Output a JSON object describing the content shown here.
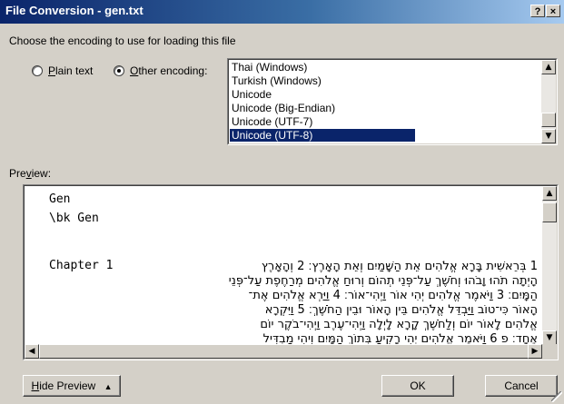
{
  "window": {
    "title": "File Conversion - gen.txt",
    "help_label": "?",
    "close_label": "×"
  },
  "prompt": "Choose the encoding to use for loading this file",
  "options": {
    "plain_text": {
      "label": "Plain text",
      "selected": false
    },
    "other_encoding": {
      "label": "Other encoding:",
      "selected": true
    }
  },
  "encodings": {
    "items": [
      "Thai (Windows)",
      "Turkish (Windows)",
      "Unicode",
      "Unicode (Big-Endian)",
      "Unicode (UTF-7)",
      "Unicode (UTF-8)"
    ],
    "selected": "Unicode (UTF-8)"
  },
  "preview": {
    "label": "Preview:",
    "lines": [
      "Gen",
      "\\bk Gen",
      "",
      "Chapter 1"
    ],
    "hebrew_lines": [
      "1 בְּרֵאשִׁית בָּרָא אֱלֹהִים אֵת הַשָּׁמַיִם וְאֵת הָאָרֶץ׃ 2 וְהָאָרֶץ",
      "הָיְתָה תֹהוּ וָבֹהוּ וְחֹשֶׁךְ עַל־פְּנֵי תְהוֹם וְרוּחַ אֱלֹהִים מְרַחֶפֶת עַל־פְּנֵי",
      "הַמָּיִם׃ 3 וַיֹּאמֶר אֱלֹהִים יְהִי אוֹר וַיְהִי־אוֹר׃ 4 וַיַּרְא אֱלֹהִים אֶת־",
      "הָאוֹר כִּי־טוֹב וַיַּבְדֵּל אֱלֹהִים בֵּין הָאוֹר וּבֵין הַחֹשֶׁךְ׃ 5 וַיִּקְרָא",
      "אֱלֹהִים לָאוֹר יוֹם וְלַחֹשֶׁךְ קָרָא לָיְלָה וַיְהִי־עֶרֶב וַיְהִי־בֹקֶר יוֹם",
      "אֶחָד׃ פ 6 וַיֹּאמֶר אֱלֹהִים יְהִי רָקִיעַ בְּתוֹךְ הַמָּיִם וִיהִי מַבְדִּיל"
    ]
  },
  "buttons": {
    "hide_preview": "Hide Preview",
    "hide_preview_icon": "up-arrow",
    "ok": "OK",
    "cancel": "Cancel"
  }
}
